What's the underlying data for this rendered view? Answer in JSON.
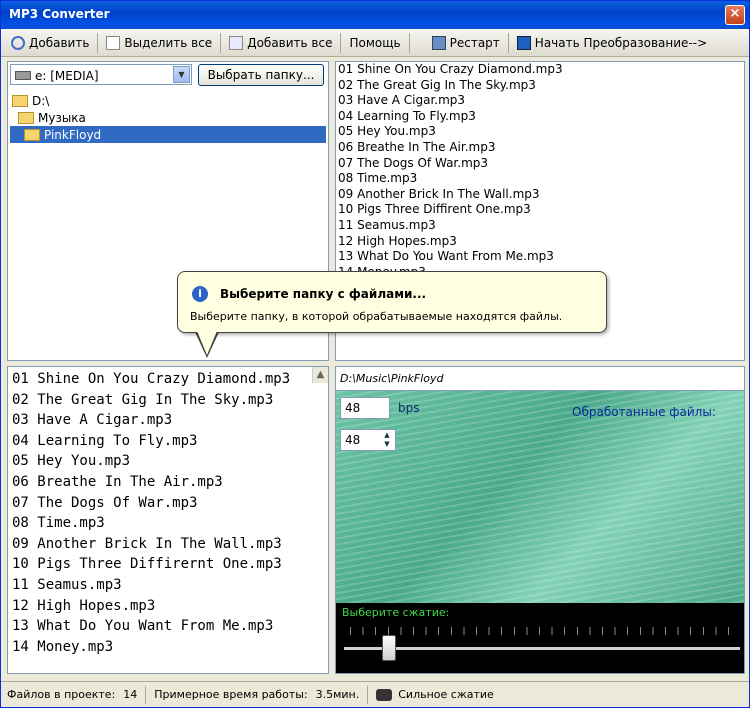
{
  "window": {
    "title": "MP3 Converter",
    "close_glyph": "×"
  },
  "toolbar": {
    "add": "Добавить",
    "select_all": "Выделить все",
    "add_all": "Добавить все",
    "help": "Помощь",
    "restart": "Рестарт",
    "start": "Начать Преобразование-->"
  },
  "browser": {
    "drive": "e: [MEDIA]",
    "choose_folder": "Выбрать папку...",
    "tree": [
      "D:\\",
      "Музыка",
      "PinkFloyd"
    ]
  },
  "files": [
    "01 Shine On You Crazy Diamond.mp3",
    "02 The Great Gig In The Sky.mp3",
    "03 Have A Cigar.mp3",
    "04 Learning To Fly.mp3",
    "05 Hey You.mp3",
    "06 Breathe In The Air.mp3",
    "07 The Dogs Of War.mp3",
    "08 Time.mp3",
    "09 Another Brick In The Wall.mp3",
    "10 Pigs Three Diffirent One.mp3",
    "11 Seamus.mp3",
    "12 High Hopes.mp3",
    "13 What Do You Want From Me.mp3",
    "14 Money.mp3"
  ],
  "tooltip": {
    "title": "Выберите папку с файлами...",
    "text": "Выберите папку, в которой обрабатываемые находятся файлы."
  },
  "project_list": [
    "01 Shine On You Crazy Diamond.mp3",
    "02 The Great Gig In The Sky.mp3",
    "03 Have A Cigar.mp3",
    "04 Learning To Fly.mp3",
    "05 Hey You.mp3",
    "06 Breathe In The Air.mp3",
    "07 The Dogs Of War.mp3",
    "08 Time.mp3",
    "09 Another Brick In The Wall.mp3",
    "10 Pigs Three Diffirernt One.mp3",
    "11 Seamus.mp3",
    "12 High Hopes.mp3",
    "13 What Do You Want From Me.mp3",
    "14 Money.mp3"
  ],
  "settings": {
    "path": "D:\\Music\\PinkFloyd",
    "bitrate": "48",
    "bitrate_unit": "bps",
    "spin_value": "48",
    "processed_label": "Обработанные файлы:",
    "compression_label": "Выберите сжатие:",
    "compression_level": 0.1
  },
  "status": {
    "files_label": "Файлов в проекте:",
    "files_count": "14",
    "time_label": "Примерное время работы:",
    "time_value": "3.5мин.",
    "mode": "Сильное сжатие"
  },
  "colors": {
    "accent": "#316ac5",
    "panel_green": "#5fb89a",
    "compress_label": "#3fd848"
  }
}
